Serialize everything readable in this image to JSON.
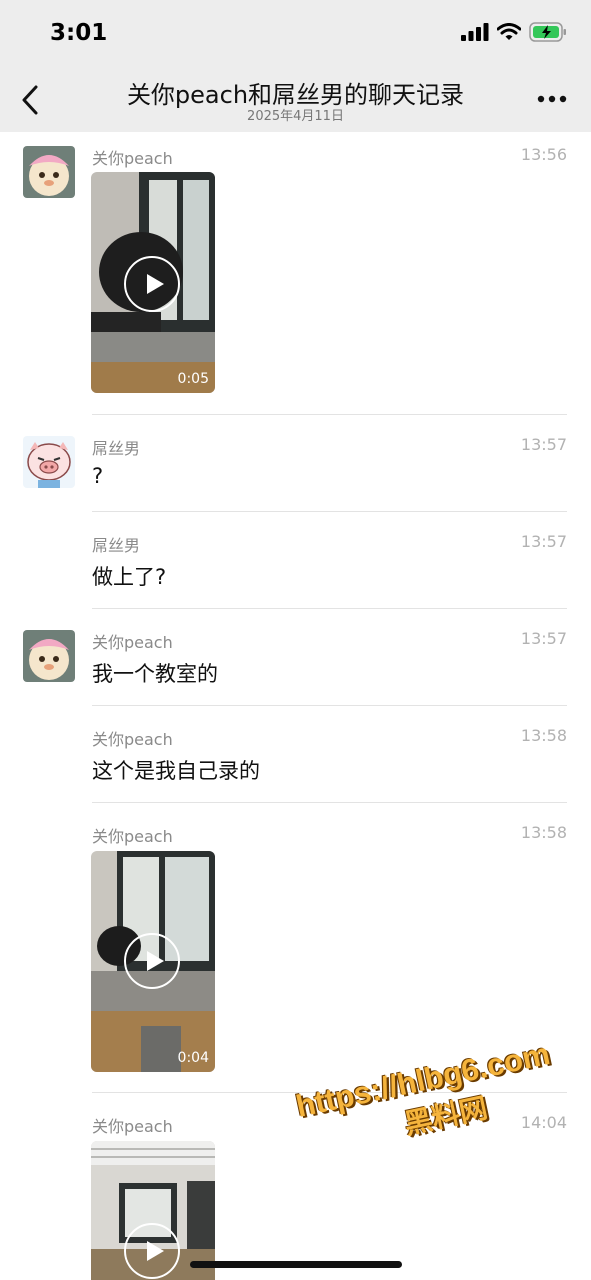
{
  "status": {
    "time": "3:01"
  },
  "nav": {
    "title": "关你peach和屌丝男的聊天记录",
    "subtitle": "2025年4月11日"
  },
  "messages": [
    {
      "sender": "关你peach",
      "time": "13:56",
      "video_duration": "0:05"
    },
    {
      "sender": "屌丝男",
      "time": "13:57",
      "text": "?"
    },
    {
      "sender": "屌丝男",
      "time": "13:57",
      "text": "做上了?"
    },
    {
      "sender": "关你peach",
      "time": "13:57",
      "text": "我一个教室的"
    },
    {
      "sender": "关你peach",
      "time": "13:58",
      "text": "这个是我自己录的"
    },
    {
      "sender": "关你peach",
      "time": "13:58",
      "video_duration": "0:04"
    },
    {
      "sender": "关你peach",
      "time": "14:04"
    }
  ],
  "watermark": {
    "url": "https://hlbg6.com",
    "name": "黑料网"
  },
  "colors": {
    "header_bg": "#ededed",
    "battery": "#34c759",
    "watermark": "#f5b43c"
  }
}
